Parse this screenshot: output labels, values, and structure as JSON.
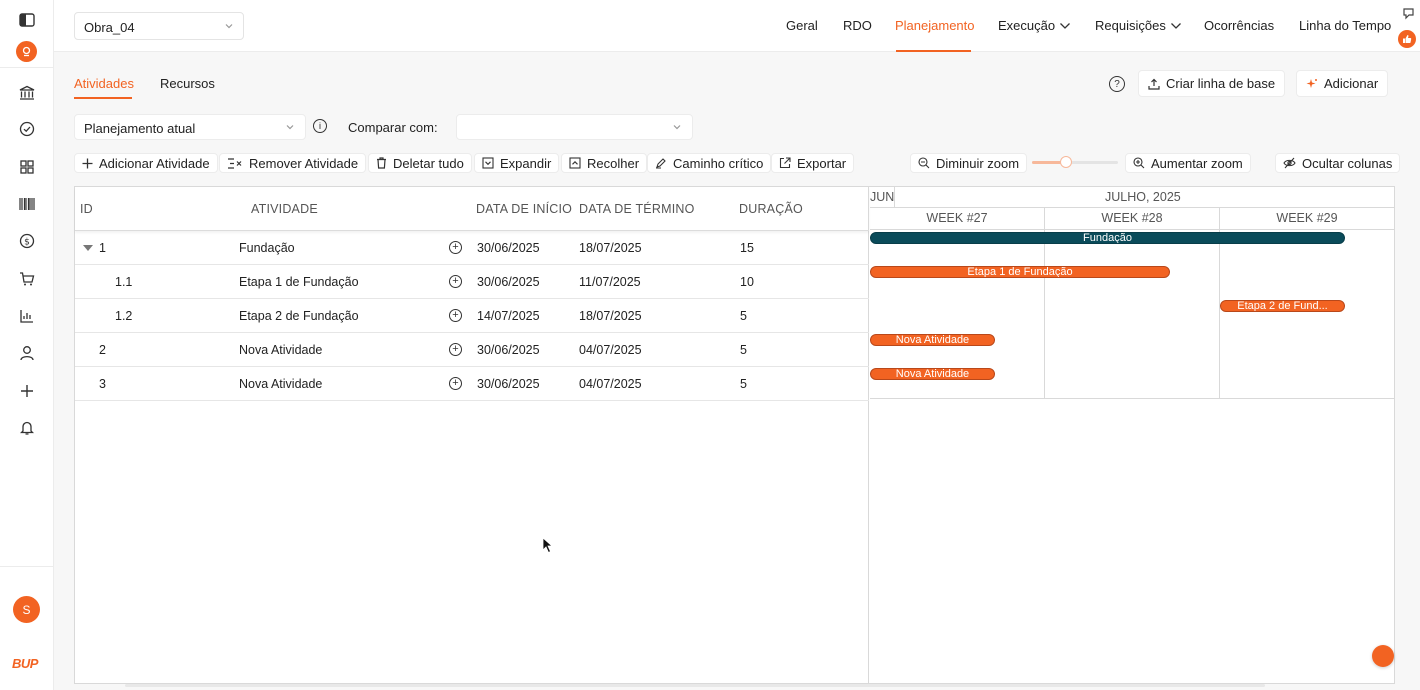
{
  "project": {
    "selected": "Obra_04"
  },
  "nav": {
    "items": [
      {
        "label": "Geral"
      },
      {
        "label": "RDO"
      },
      {
        "label": "Planejamento"
      },
      {
        "label": "Execução"
      },
      {
        "label": "Requisições"
      },
      {
        "label": "Ocorrências"
      },
      {
        "label": "Linha do Tempo"
      }
    ],
    "active": "Planejamento"
  },
  "user": {
    "initial": "S"
  },
  "brand": {
    "logo_text": "BUP"
  },
  "tabs": [
    {
      "label": "Atividades"
    },
    {
      "label": "Recursos"
    }
  ],
  "actions": {
    "baseline_label": "Criar linha de base",
    "add_label": "Adicionar"
  },
  "plan": {
    "selected": "Planejamento atual",
    "compare_label": "Comparar com:",
    "compare_value": ""
  },
  "toolbar": {
    "add_activity": "Adicionar Atividade",
    "remove_activity": "Remover Atividade",
    "delete_all": "Deletar tudo",
    "expand": "Expandir",
    "collapse": "Recolher",
    "critical_path": "Caminho crítico",
    "export": "Exportar",
    "zoom_out": "Diminuir zoom",
    "zoom_in": "Aumentar zoom",
    "hide_columns": "Ocultar colunas",
    "zoom_level": 0.4
  },
  "table": {
    "headers": {
      "id": "ID",
      "activity": "ATIVIDADE",
      "start": "DATA DE INÍCIO",
      "end": "DATA DE TÉRMINO",
      "duration": "DURAÇÃO"
    },
    "rows": [
      {
        "id": "1",
        "activity": "Fundação",
        "start": "30/06/2025",
        "end": "18/07/2025",
        "duration": "15"
      },
      {
        "id": "1.1",
        "activity": "Etapa 1 de Fundação",
        "start": "30/06/2025",
        "end": "11/07/2025",
        "duration": "10"
      },
      {
        "id": "1.2",
        "activity": "Etapa 2 de Fundação",
        "start": "14/07/2025",
        "end": "18/07/2025",
        "duration": "5"
      },
      {
        "id": "2",
        "activity": "Nova Atividade",
        "start": "30/06/2025",
        "end": "04/07/2025",
        "duration": "5"
      },
      {
        "id": "3",
        "activity": "Nova Atividade",
        "start": "30/06/2025",
        "end": "04/07/2025",
        "duration": "5"
      }
    ]
  },
  "gantt": {
    "month_prev": "JUN",
    "month": "JULHO, 2025",
    "weeks": [
      "WEEK #27",
      "WEEK #28",
      "WEEK #29"
    ],
    "bars": [
      {
        "label": "Fundação",
        "type": "parent"
      },
      {
        "label": "Etapa 1 de Fundação",
        "type": "task"
      },
      {
        "label": "Etapa 2 de Fund...",
        "type": "task"
      },
      {
        "label": "Nova Atividade",
        "type": "task"
      },
      {
        "label": "Nova Atividade",
        "type": "task"
      }
    ]
  },
  "colors": {
    "accent": "#f26322",
    "parent_bar": "#0a4b5a"
  }
}
